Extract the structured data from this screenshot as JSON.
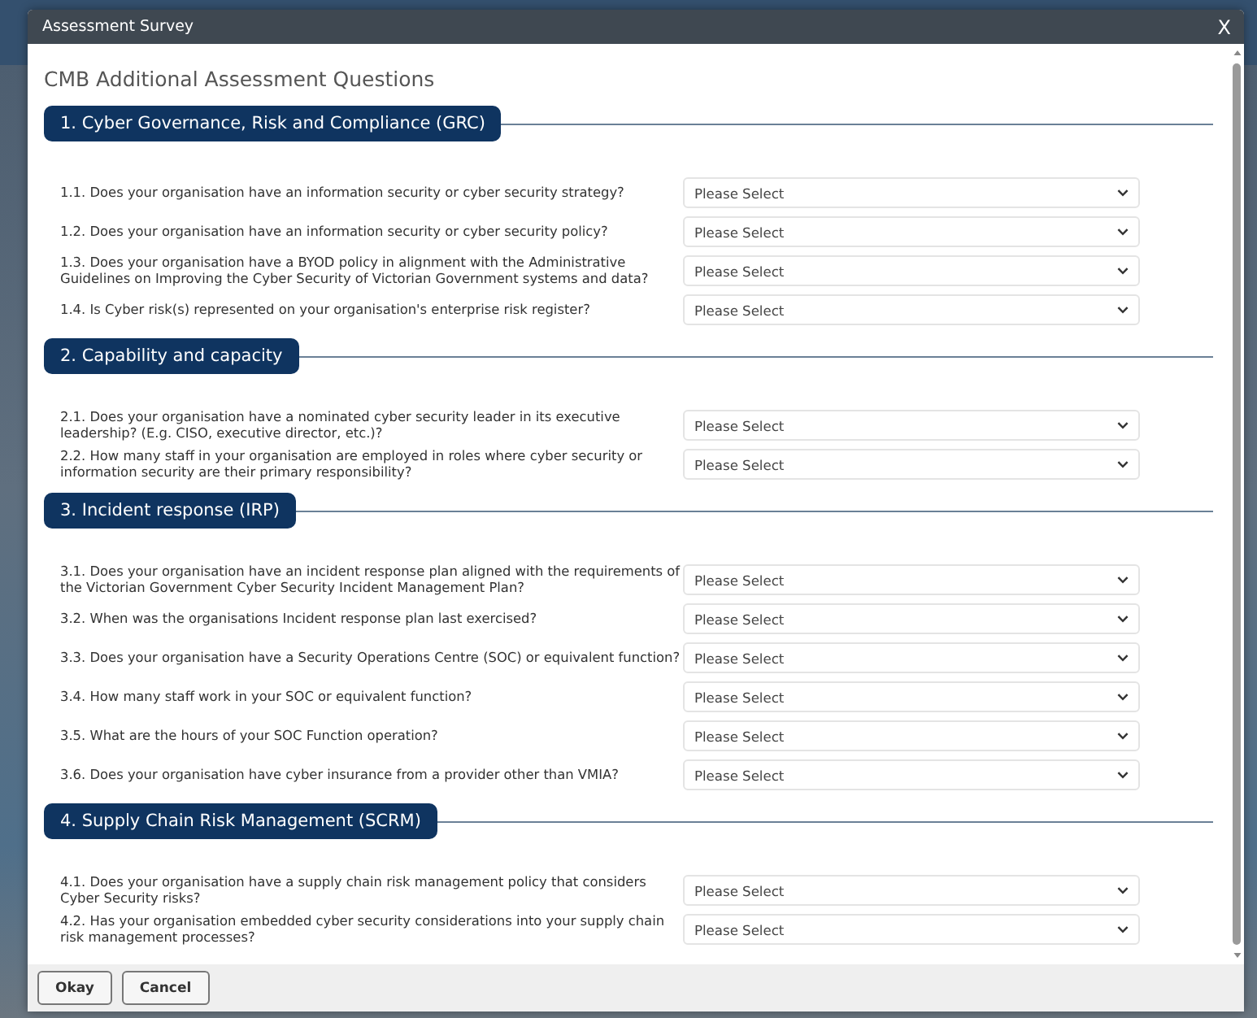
{
  "dialog": {
    "title": "Assessment Survey",
    "close": "X"
  },
  "heading": "CMB Additional Assessment Questions",
  "sections": [
    {
      "title": "1. Cyber Governance, Risk and Compliance (GRC)",
      "questions": [
        {
          "text": "1.1. Does your organisation have an information security or cyber security strategy?",
          "value": "Please Select"
        },
        {
          "text": "1.2. Does your organisation have an information security or cyber security policy?",
          "value": "Please Select"
        },
        {
          "text": "1.3. Does your organisation have a BYOD policy in alignment with the Administrative Guidelines on Improving the Cyber Security of Victorian Government systems and data?",
          "value": "Please Select"
        },
        {
          "text": "1.4. Is Cyber risk(s) represented on your organisation's enterprise risk register?",
          "value": "Please Select"
        }
      ]
    },
    {
      "title": "2. Capability and capacity",
      "questions": [
        {
          "text": "2.1. Does your organisation have a nominated cyber security leader in its executive leadership? (E.g. CISO, executive director, etc.)?",
          "value": "Please Select"
        },
        {
          "text": "2.2. How many staff in your organisation are employed in roles where cyber security or information security are their primary responsibility?",
          "value": "Please Select"
        }
      ]
    },
    {
      "title": "3. Incident response (IRP)",
      "questions": [
        {
          "text": "3.1. Does your organisation have an incident response plan aligned with the requirements of the Victorian Government Cyber Security Incident Management Plan?",
          "value": "Please Select"
        },
        {
          "text": "3.2. When was the organisations Incident response plan last exercised?",
          "value": "Please Select"
        },
        {
          "text": "3.3. Does your organisation have a Security Operations Centre (SOC) or equivalent function?",
          "value": "Please Select"
        },
        {
          "text": "3.4. How many staff work in your SOC or equivalent function?",
          "value": "Please Select"
        },
        {
          "text": "3.5. What are the hours of your SOC Function operation?",
          "value": "Please Select"
        },
        {
          "text": "3.6. Does your organisation have cyber insurance from a provider other than VMIA?",
          "value": "Please Select"
        }
      ]
    },
    {
      "title": "4. Supply Chain Risk Management (SCRM)",
      "questions": [
        {
          "text": "4.1. Does your organisation have a supply chain risk management policy that considers Cyber Security risks?",
          "value": "Please Select"
        },
        {
          "text": "4.2. Has your organisation embedded cyber security considerations into your supply chain risk management processes?",
          "value": "Please Select"
        }
      ]
    }
  ],
  "buttons": [
    "Okay",
    "Cancel"
  ]
}
